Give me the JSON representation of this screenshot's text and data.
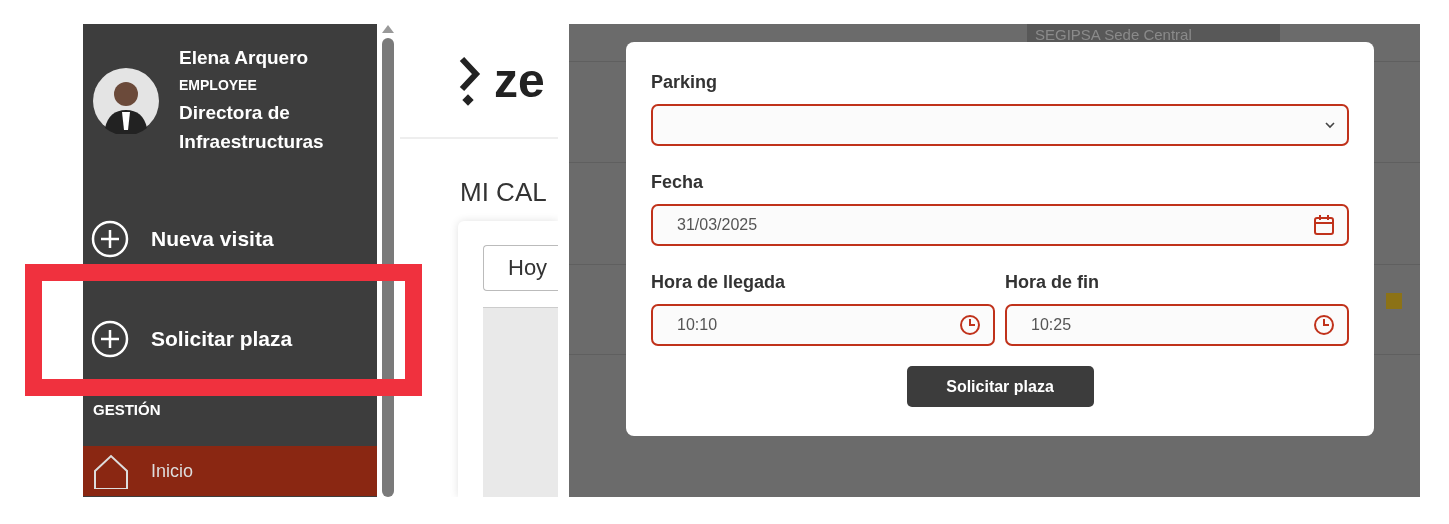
{
  "sidebar": {
    "user": {
      "name": "Elena Arquero",
      "role": "EMPLOYEE",
      "position": "Directora de Infraestructuras"
    },
    "actions": [
      {
        "label": "Nueva visita",
        "highlighted": false
      },
      {
        "label": "Solicitar plaza",
        "highlighted": true
      }
    ],
    "section": "GESTIÓN",
    "menu": [
      {
        "label": "Inicio",
        "selected": true
      }
    ]
  },
  "main": {
    "logo": "ze",
    "heading": "MI CAL",
    "today_button": "Hoy"
  },
  "background": {
    "location_tag": "SEGIPSA Sede Central"
  },
  "modal": {
    "rows": [
      [
        {
          "label": "Parking",
          "kind": "select"
        }
      ],
      [
        {
          "label": "Fecha",
          "kind": "date",
          "value": "31/03/2025"
        }
      ],
      [
        {
          "label": "Hora de llegada",
          "kind": "time",
          "value": "10:10"
        },
        {
          "label": "Hora de fin",
          "kind": "time",
          "value": "10:25"
        }
      ]
    ],
    "submit": "Solicitar plaza"
  }
}
